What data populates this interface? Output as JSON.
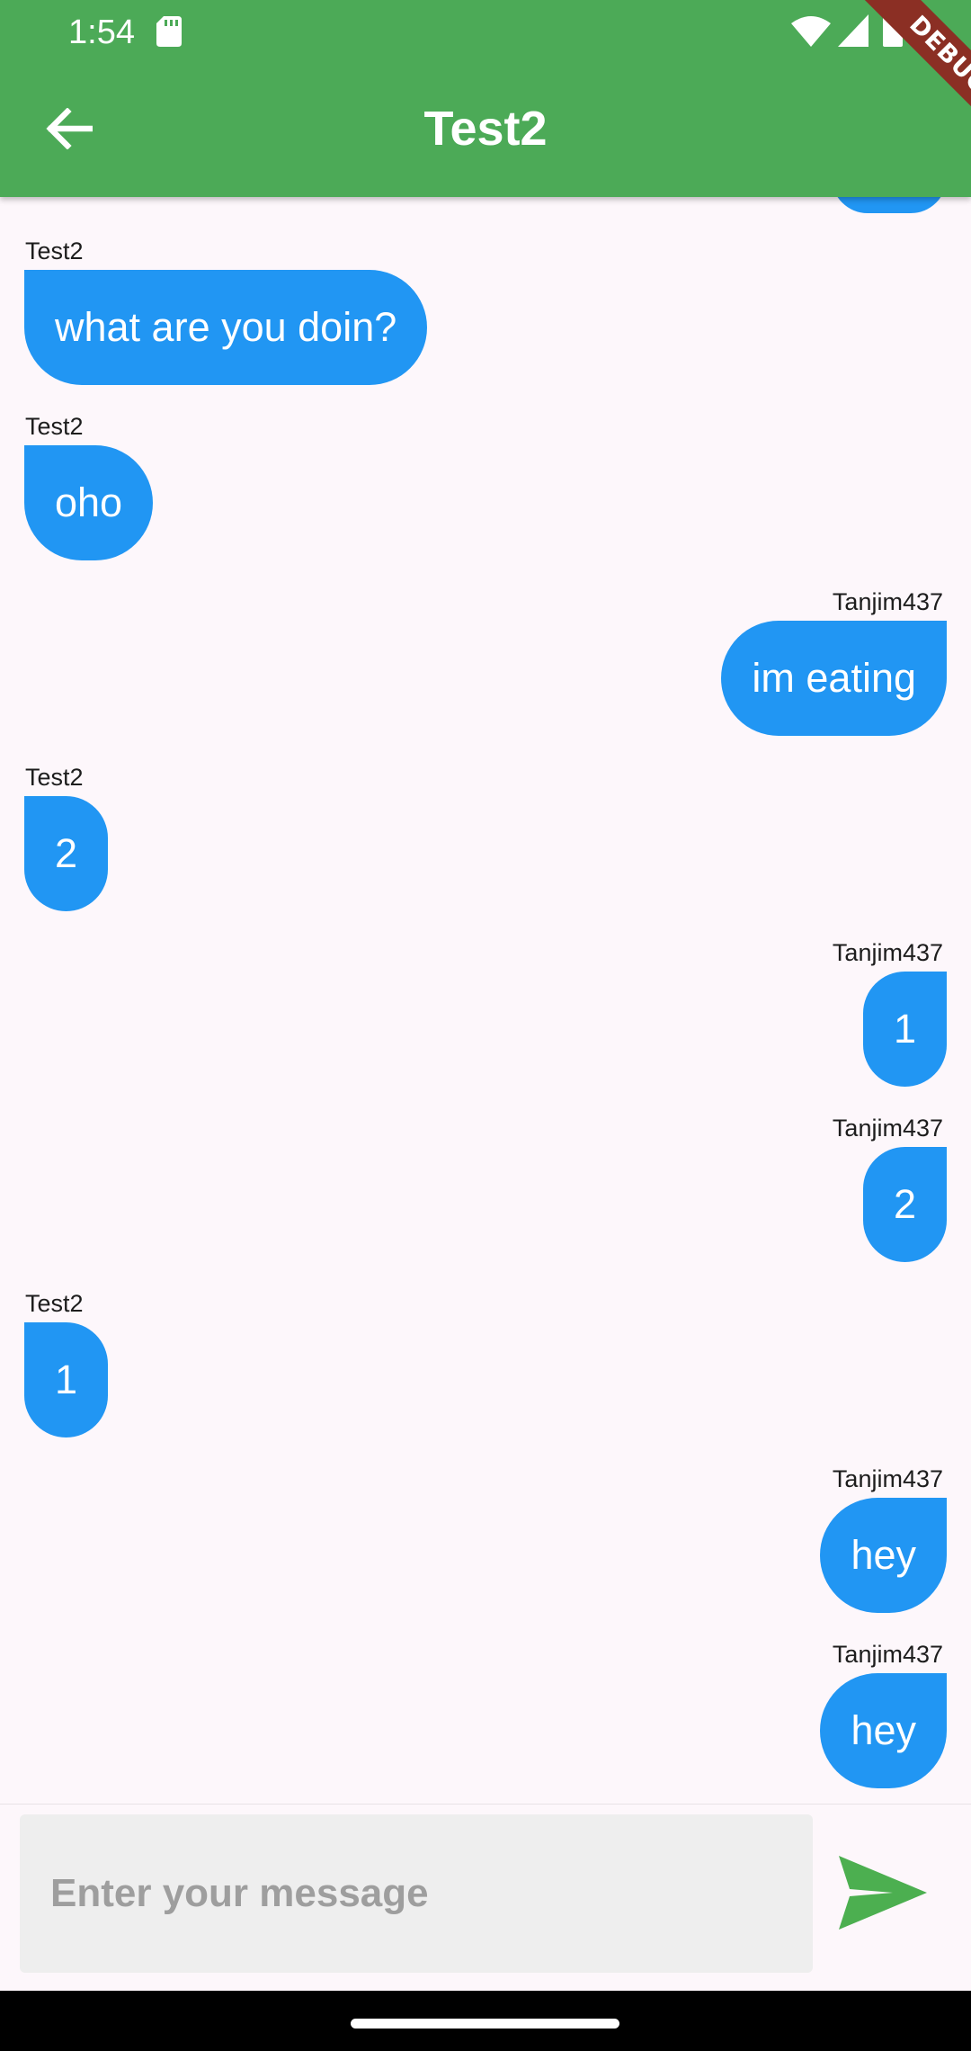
{
  "status_bar": {
    "time": "1:54"
  },
  "debug_banner": "DEBUG",
  "app_bar": {
    "title": "Test2"
  },
  "messages": [
    {
      "sender": "Test2",
      "text": "what are you doin?",
      "direction": "in"
    },
    {
      "sender": "Test2",
      "text": "oho",
      "direction": "in"
    },
    {
      "sender": "Tanjim437",
      "text": "im eating",
      "direction": "out"
    },
    {
      "sender": "Test2",
      "text": "2",
      "direction": "in"
    },
    {
      "sender": "Tanjim437",
      "text": "1",
      "direction": "out"
    },
    {
      "sender": "Tanjim437",
      "text": "2",
      "direction": "out"
    },
    {
      "sender": "Test2",
      "text": "1",
      "direction": "in"
    },
    {
      "sender": "Tanjim437",
      "text": "hey",
      "direction": "out"
    },
    {
      "sender": "Tanjim437",
      "text": "hey",
      "direction": "out"
    }
  ],
  "composer": {
    "placeholder": "Enter your message",
    "value": ""
  },
  "colors": {
    "app_bar": "#4caa57",
    "bubble": "#2196f3",
    "send_icon": "#4caf50",
    "background": "#fdf7fb"
  }
}
